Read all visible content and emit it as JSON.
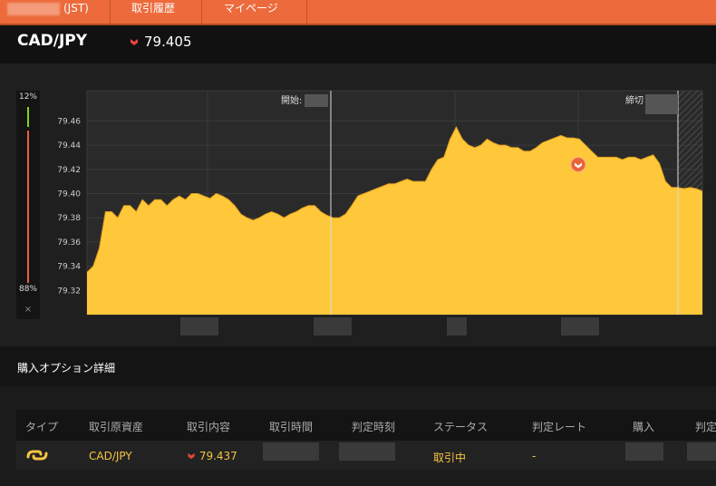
{
  "header": {
    "time_suffix": "(JST)",
    "tabs": [
      "取引履歴",
      "マイページ"
    ]
  },
  "pair": {
    "name": "CAD/JPY",
    "rate": "79.405",
    "direction": "down"
  },
  "meter": {
    "top": "12%",
    "bottom": "88%",
    "close": "×"
  },
  "chart": {
    "start_label": "開始:",
    "end_label": "締切",
    "y_ticks": [
      "79.46",
      "79.44",
      "79.42",
      "79.40",
      "79.38",
      "79.36",
      "79.34",
      "79.32"
    ],
    "y_range": [
      79.3,
      79.485
    ],
    "marker_rate": 79.424,
    "series": [
      79.335,
      79.34,
      79.355,
      79.385,
      79.385,
      79.38,
      79.39,
      79.39,
      79.385,
      79.395,
      79.39,
      79.395,
      79.395,
      79.39,
      79.395,
      79.398,
      79.395,
      79.4,
      79.4,
      79.398,
      79.396,
      79.4,
      79.398,
      79.395,
      79.39,
      79.383,
      79.38,
      79.378,
      79.38,
      79.383,
      79.385,
      79.383,
      79.38,
      79.383,
      79.385,
      79.388,
      79.39,
      79.39,
      79.385,
      79.382,
      79.38,
      79.38,
      79.383,
      79.39,
      79.398,
      79.4,
      79.402,
      79.404,
      79.406,
      79.408,
      79.408,
      79.41,
      79.412,
      79.41,
      79.41,
      79.41,
      79.42,
      79.428,
      79.43,
      79.445,
      79.455,
      79.445,
      79.44,
      79.438,
      79.44,
      79.445,
      79.442,
      79.44,
      79.44,
      79.438,
      79.438,
      79.435,
      79.435,
      79.438,
      79.442,
      79.444,
      79.446,
      79.448,
      79.446,
      79.446,
      79.445,
      79.44,
      79.435,
      79.43,
      79.43,
      79.43,
      79.43,
      79.428,
      79.43,
      79.43,
      79.428,
      79.43,
      79.432,
      79.425,
      79.41,
      79.405,
      79.405,
      79.404,
      79.405,
      79.404,
      79.402
    ]
  },
  "section": {
    "title": "購入オプション詳細"
  },
  "table": {
    "headers": [
      "タイプ",
      "取引原資産",
      "取引内容",
      "取引時間",
      "判定時刻",
      "ステータス",
      "判定レート",
      "購入",
      "判定"
    ],
    "row": {
      "asset": "CAD/JPY",
      "content_rate": "79.437",
      "status": "取引中",
      "judge_rate": "-"
    }
  },
  "colors": {
    "accent": "#ec6a3b",
    "area": "#ffc83a",
    "status": "#f5c542"
  }
}
